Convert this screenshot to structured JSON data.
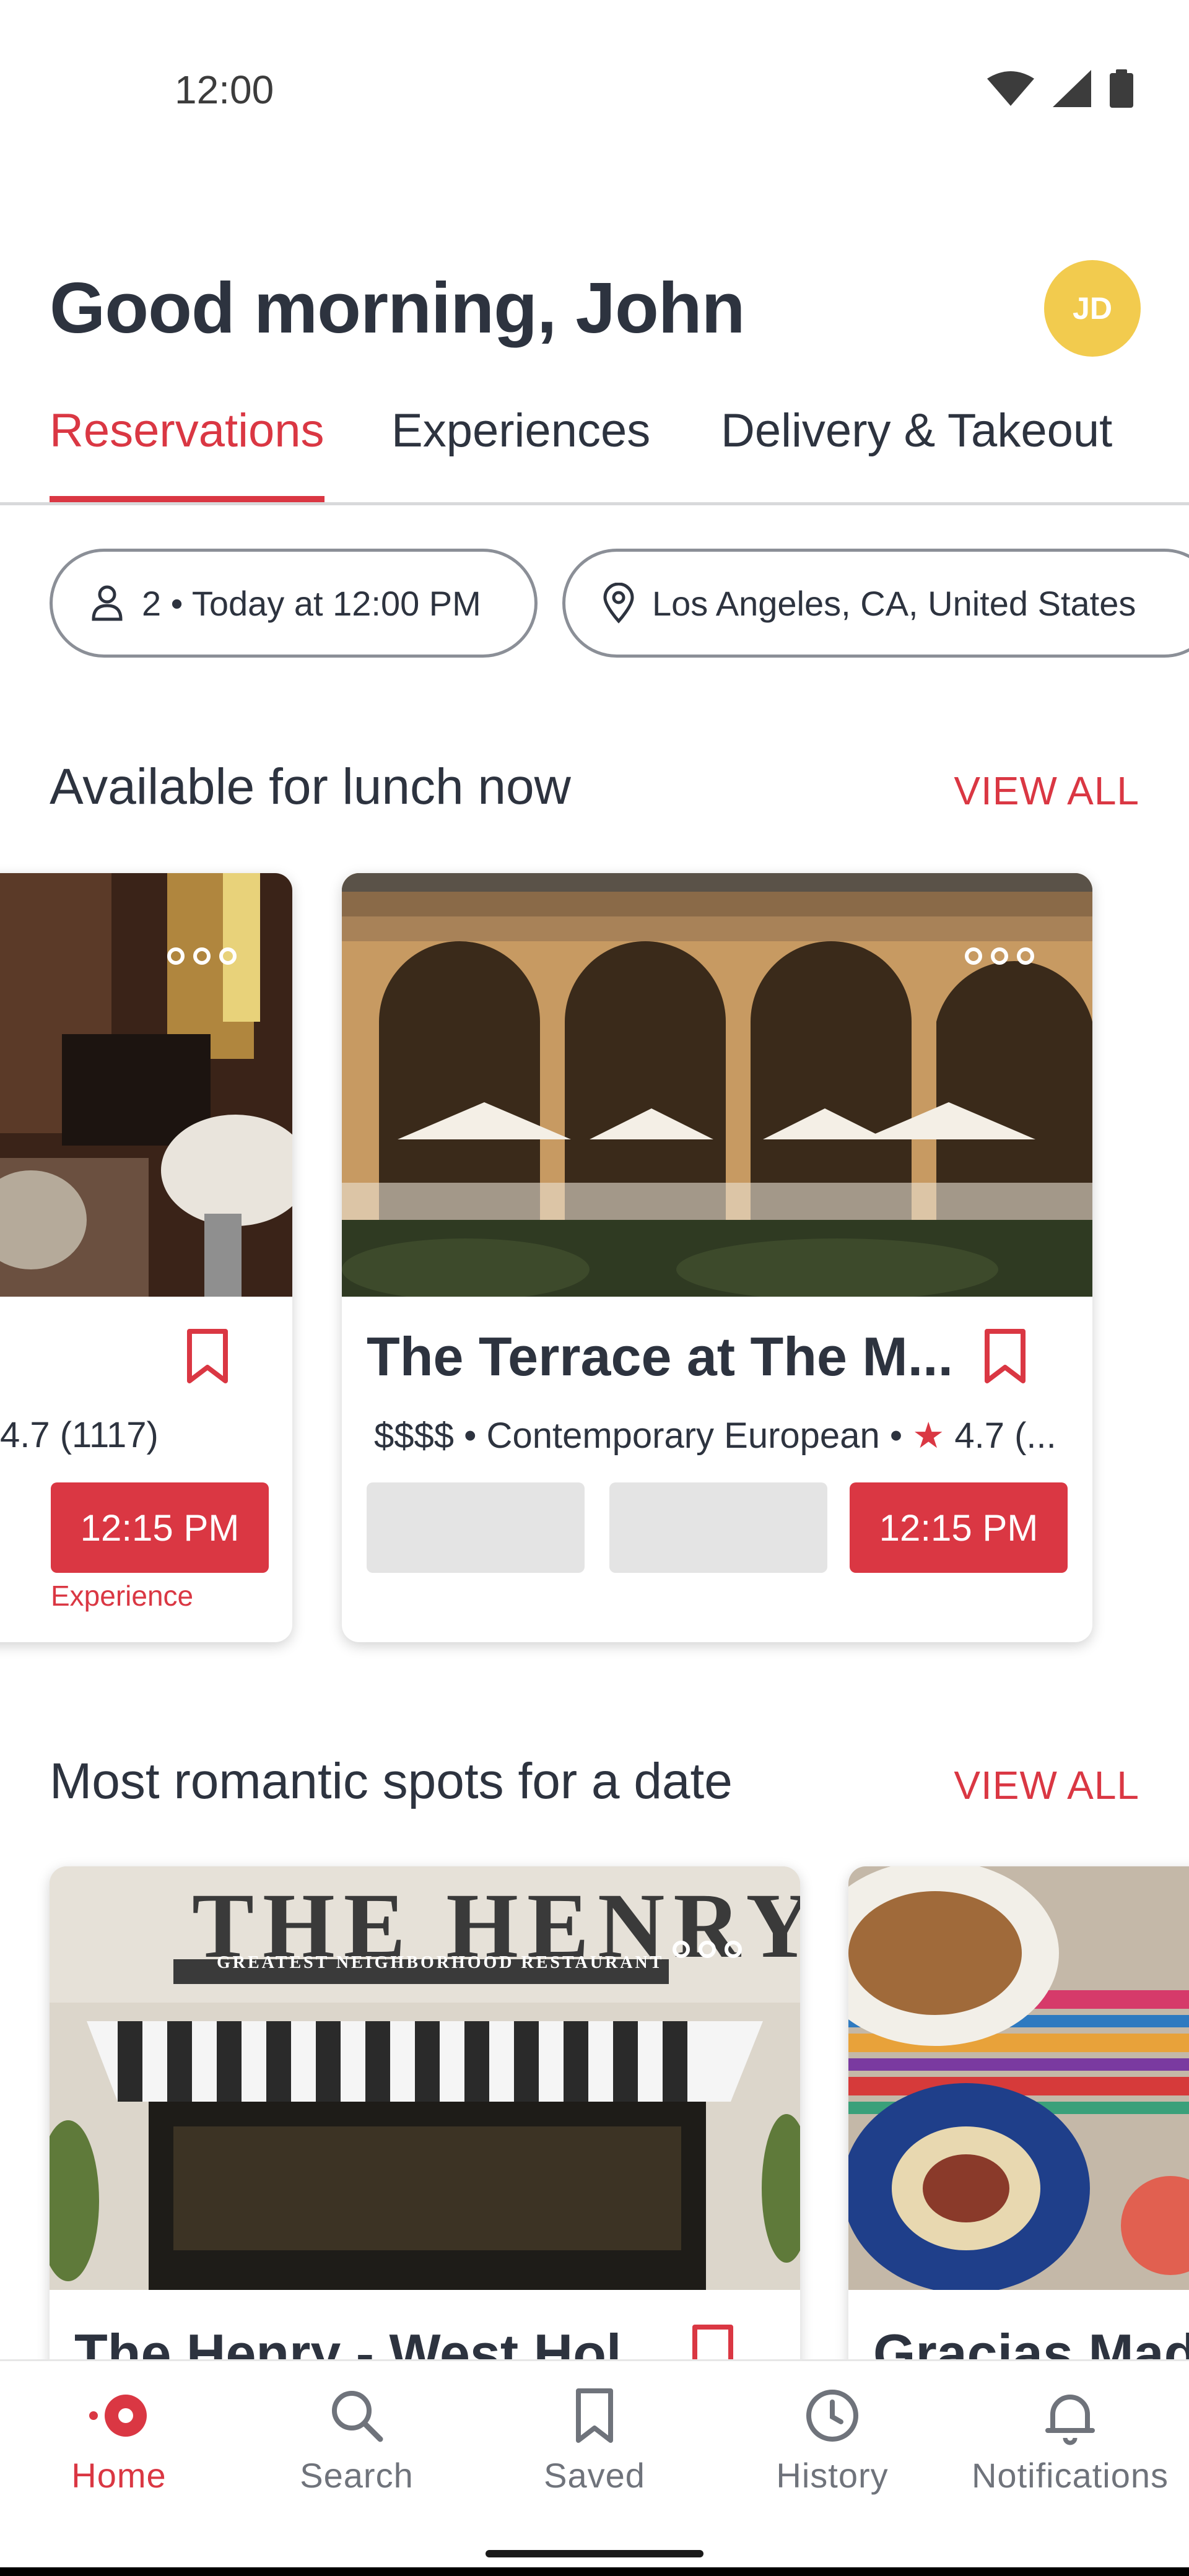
{
  "status": {
    "time": "12:00"
  },
  "header": {
    "greeting": "Good morning, John",
    "avatar_initials": "JD"
  },
  "tabs": [
    {
      "label": "Reservations",
      "active": true
    },
    {
      "label": "Experiences",
      "active": false
    },
    {
      "label": "Delivery & Takeout",
      "active": false
    }
  ],
  "filters": {
    "party": "2 • Today at 12:00 PM",
    "location": "Los Angeles, CA, United States"
  },
  "sections": {
    "lunch": {
      "title": "Available for lunch now",
      "view_all": "VIEW ALL",
      "cards": [
        {
          "name": "",
          "meta": "4.7 (1117)",
          "slots": [
            "12:15 PM"
          ],
          "slot_tag": "Experience"
        },
        {
          "name": "The Terrace at The M...",
          "meta_price": "$$$$ • Contemporary European •",
          "meta_rating_star": "★",
          "meta_rating": "4.7 (...",
          "slots": [
            "12:15 PM"
          ]
        }
      ]
    },
    "romantic": {
      "title": "Most romantic spots for a date",
      "view_all": "VIEW ALL",
      "cards": [
        {
          "name": "The Henry - West Hol...",
          "sign_text": "THE HENRY",
          "sign_sub": "GREATEST NEIGHBORHOOD RESTAURANT"
        },
        {
          "name": "Gracias Madre"
        }
      ]
    }
  },
  "bottom_nav": [
    {
      "label": "Home",
      "icon": "home-icon",
      "active": true
    },
    {
      "label": "Search",
      "icon": "search-icon",
      "active": false
    },
    {
      "label": "Saved",
      "icon": "bookmark-icon",
      "active": false
    },
    {
      "label": "History",
      "icon": "history-icon",
      "active": false
    },
    {
      "label": "Notifications",
      "icon": "bell-icon",
      "active": false
    }
  ],
  "colors": {
    "accent": "#da3743",
    "avatar": "#f2cb4e",
    "text": "#2d333f"
  }
}
